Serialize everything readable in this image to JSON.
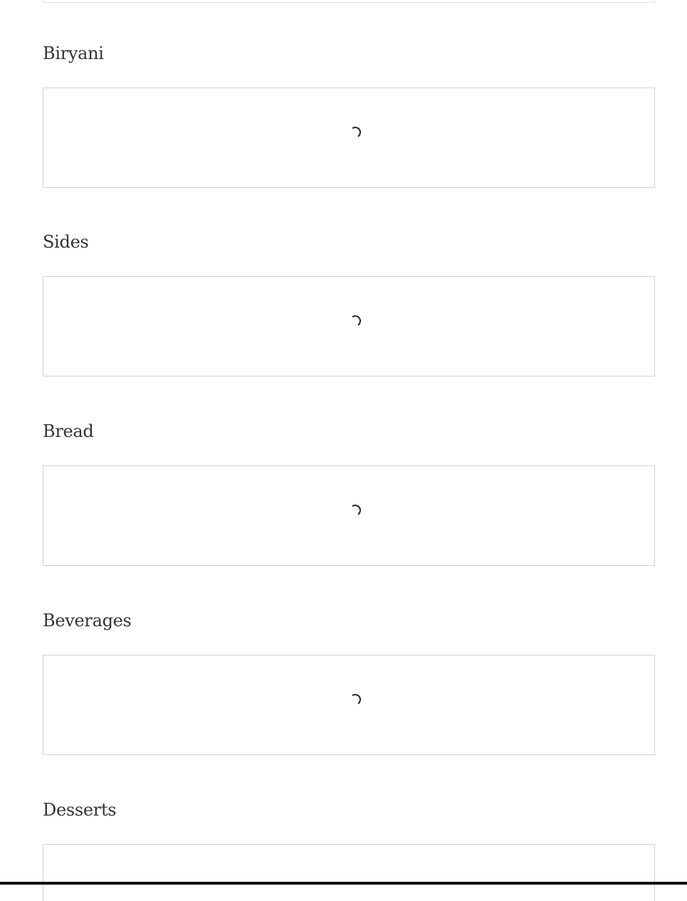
{
  "sections": [
    {
      "title": "Biryani",
      "status": "loading"
    },
    {
      "title": "Sides",
      "status": "loading"
    },
    {
      "title": "Bread",
      "status": "loading"
    },
    {
      "title": "Beverages",
      "status": "loading"
    },
    {
      "title": "Desserts",
      "status": "loading"
    }
  ],
  "colors": {
    "text": "#333333",
    "border": "#d0d0d0",
    "spinner": "#222222",
    "background": "#ffffff"
  },
  "icons": {
    "loading": "spinner-icon"
  }
}
